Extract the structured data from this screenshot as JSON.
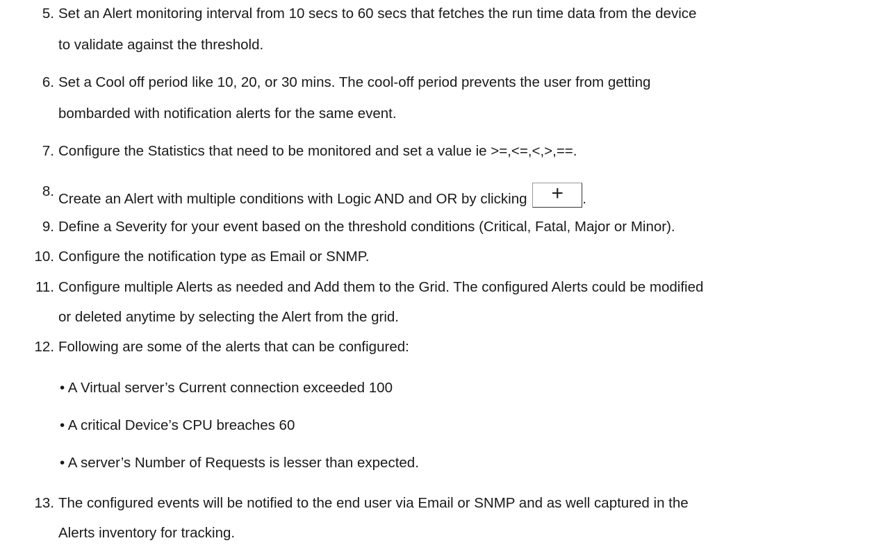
{
  "items": [
    {
      "num": "5.",
      "lines": [
        "Set an Alert monitoring interval from 10 secs to 60 secs that fetches the run time data from the device",
        "to validate against the threshold."
      ]
    },
    {
      "num": "6.",
      "lines": [
        "Set a Cool off period like 10, 20, or 30 mins. The cool-off period prevents the user from getting",
        "bombarded with notification alerts for the same event."
      ]
    },
    {
      "num": "7.",
      "lines": [
        "Configure the Statistics that need to be monitored and set a value ie >=,<=,<,>,==."
      ]
    },
    {
      "num": "8.",
      "text_before": "Create an Alert with multiple conditions with Logic AND and OR by clicking",
      "button_glyph": "+",
      "text_after": "."
    },
    {
      "num": "9.",
      "lines": [
        "Define a Severity for your event based on the threshold conditions (Critical, Fatal, Major or Minor)."
      ]
    },
    {
      "num": "10.",
      "lines": [
        "Configure the notification type as Email or SNMP."
      ]
    },
    {
      "num": "11.",
      "lines": [
        "Configure multiple Alerts as needed and Add them to the Grid. The configured Alerts could be modified",
        "or deleted anytime by selecting the Alert from the grid."
      ]
    },
    {
      "num": "12.",
      "lines": [
        "Following are some of the alerts that can be configured:"
      ]
    },
    {
      "num": "13.",
      "lines": [
        "The configured events will be notified to the end user via Email or SNMP and as well captured in the",
        "Alerts inventory for tracking."
      ]
    }
  ],
  "bullets": [
    "• A Virtual server’s Current connection exceeded 100",
    "• A critical Device’s CPU breaches 60",
    "• A server’s Number of Requests is lesser than expected."
  ]
}
